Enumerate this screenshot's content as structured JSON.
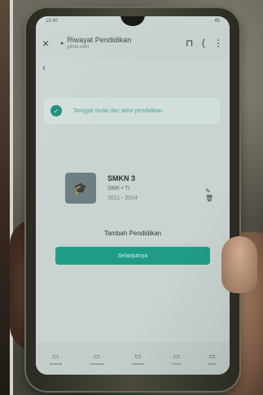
{
  "status": {
    "time": "15:40",
    "battery": "45"
  },
  "browser": {
    "close_icon": "×",
    "title": "Riwayat Pendidikan",
    "url": "glints.com",
    "bookmark_icon": "⊓",
    "share_icon": "⟨",
    "menu_icon": "⋮"
  },
  "page": {
    "back_icon": "‹",
    "notice": "Tanggal mulai dan akhir pendidikan"
  },
  "education": {
    "school": "SMKN 3",
    "major": "SMK • TI",
    "years": "2011 - 2014",
    "edit_icon": "✎ 🗑"
  },
  "actions": {
    "add_label": "Tambah Pendidikan",
    "next_label": "Selanjutnya"
  },
  "nav": [
    {
      "icon": "▭",
      "label": "Beranda"
    },
    {
      "icon": "▭",
      "label": "Lowongan"
    },
    {
      "icon": "▭",
      "label": "Lamaran"
    },
    {
      "icon": "▭",
      "label": "Pesan"
    },
    {
      "icon": "▭",
      "label": "Akun"
    }
  ],
  "colors": {
    "accent": "#1f9c86",
    "screen_bg": "#c9d4d1"
  }
}
